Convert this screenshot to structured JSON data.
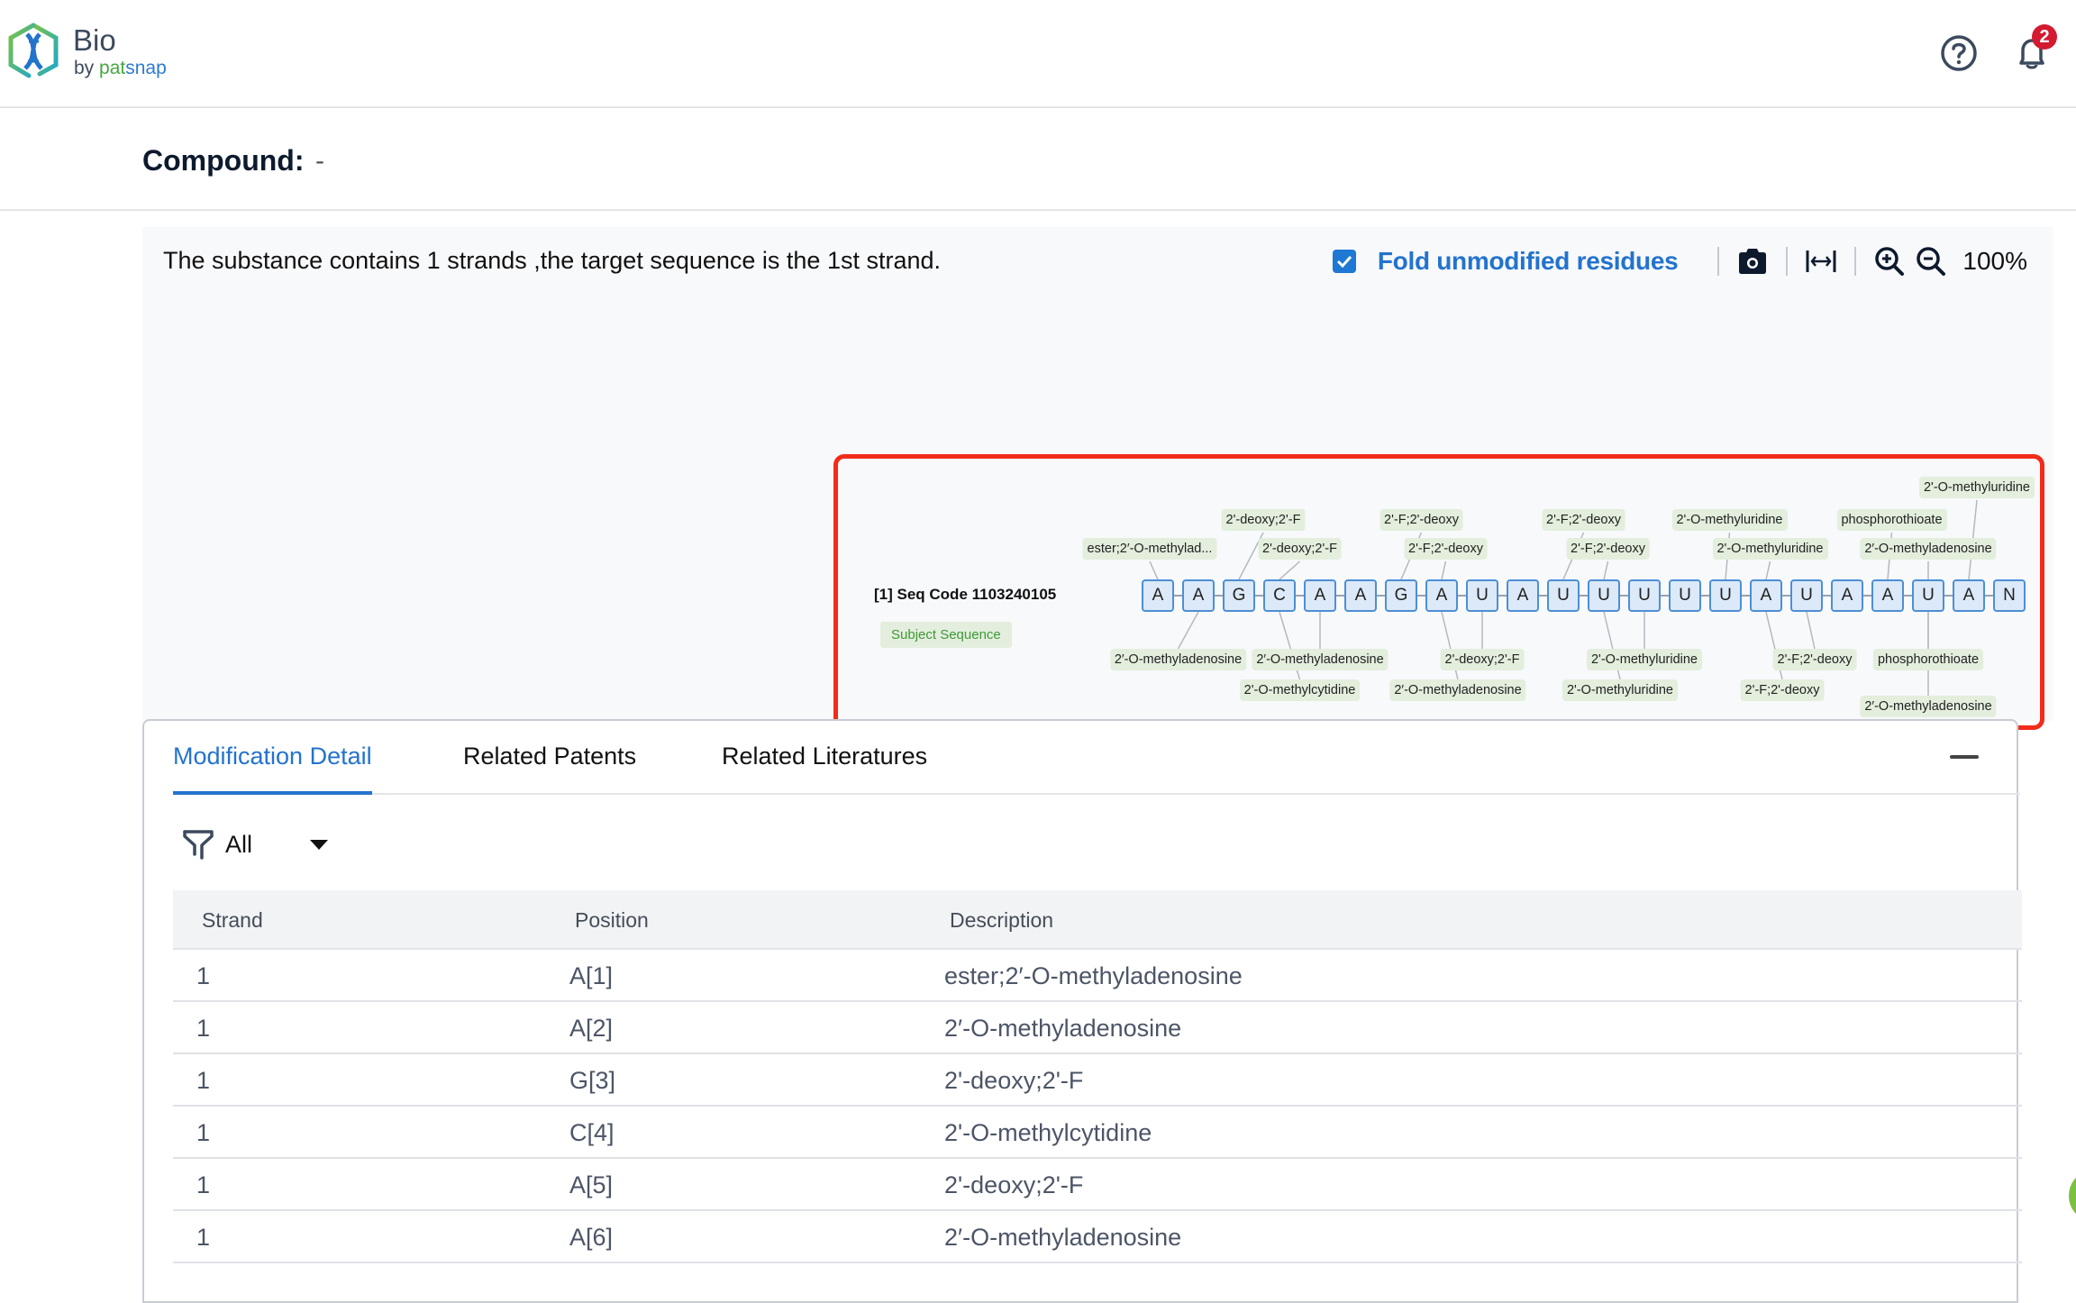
{
  "app": {
    "brand_title": "Bio",
    "brand_by": "by ",
    "brand_pat": "pat",
    "brand_snap": "snap",
    "notifications_count": "2"
  },
  "compound": {
    "label": "Compound:",
    "value": "-"
  },
  "viewer": {
    "message": "The substance contains 1 strands ,the target sequence is the 1st strand.",
    "fold_checked": true,
    "fold_label": "Fold unmodified residues",
    "zoom_level": "100%",
    "sequence_title": "[1] Seq Code 1103240105",
    "subject_tag": "Subject Sequence",
    "residues": [
      "A",
      "A",
      "G",
      "C",
      "A",
      "A",
      "G",
      "A",
      "U",
      "A",
      "U",
      "U",
      "U",
      "U",
      "U",
      "A",
      "U",
      "A",
      "A",
      "U",
      "A",
      "N"
    ],
    "modifications": [
      {
        "text": "ester;2′-O-methylad...",
        "side": "top",
        "row": 2,
        "residue": 1,
        "offset": -0.2
      },
      {
        "text": "2'-deoxy;2'-F",
        "side": "top",
        "row": 1,
        "residue": 3,
        "offset": 0.6
      },
      {
        "text": "2'-deoxy;2'-F",
        "side": "top",
        "row": 2,
        "residue": 4,
        "offset": 0.5
      },
      {
        "text": "2'-F;2'-deoxy",
        "side": "top",
        "row": 1,
        "residue": 7,
        "offset": 0.5
      },
      {
        "text": "2'-F;2'-deoxy",
        "side": "top",
        "row": 2,
        "residue": 8,
        "offset": 0.1
      },
      {
        "text": "2'-F;2'-deoxy",
        "side": "top",
        "row": 1,
        "residue": 11,
        "offset": 0.5
      },
      {
        "text": "2'-F;2'-deoxy",
        "side": "top",
        "row": 2,
        "residue": 12,
        "offset": 0.1
      },
      {
        "text": "2'-O-methyluridine",
        "side": "top",
        "row": 1,
        "residue": 15,
        "offset": 0.1
      },
      {
        "text": "2'-O-methyluridine",
        "side": "top",
        "row": 2,
        "residue": 16,
        "offset": 0.1
      },
      {
        "text": "phosphorothioate",
        "side": "top",
        "row": 1,
        "residue": 19,
        "offset": 0.1
      },
      {
        "text": "2′-O-methyladenosine",
        "side": "top",
        "row": 2,
        "residue": 20,
        "offset": 0.0
      },
      {
        "text": "2'-O-methyluridine",
        "side": "top",
        "row": 0,
        "residue": 21,
        "offset": 0.2
      },
      {
        "text": "2′-O-methyladenosine",
        "side": "bottom",
        "row": 1,
        "residue": 2,
        "offset": -0.5
      },
      {
        "text": "2′-O-methyladenosine",
        "side": "bottom",
        "row": 1,
        "residue": 5,
        "offset": 0.0
      },
      {
        "text": "2'-O-methylcytidine",
        "side": "bottom",
        "row": 2,
        "residue": 4,
        "offset": 0.5
      },
      {
        "text": "2'-deoxy;2'-F",
        "side": "bottom",
        "row": 1,
        "residue": 9,
        "offset": 0.0
      },
      {
        "text": "2′-O-methyladenosine",
        "side": "bottom",
        "row": 2,
        "residue": 8,
        "offset": 0.4
      },
      {
        "text": "2'-O-methyluridine",
        "side": "bottom",
        "row": 1,
        "residue": 13,
        "offset": 0.0
      },
      {
        "text": "2'-O-methyluridine",
        "side": "bottom",
        "row": 2,
        "residue": 12,
        "offset": 0.4
      },
      {
        "text": "2'-F;2'-deoxy",
        "side": "bottom",
        "row": 1,
        "residue": 17,
        "offset": 0.2
      },
      {
        "text": "2'-F;2'-deoxy",
        "side": "bottom",
        "row": 2,
        "residue": 16,
        "offset": 0.4
      },
      {
        "text": "phosphorothioate",
        "side": "bottom",
        "row": 1,
        "residue": 20,
        "offset": 0.0
      },
      {
        "text": "2′-O-methyladenosine",
        "side": "bottom",
        "row": 3,
        "residue": 20,
        "offset": 0.0
      }
    ]
  },
  "panel": {
    "tabs": [
      {
        "label": "Modification Detail",
        "active": true
      },
      {
        "label": "Related Patents",
        "active": false
      },
      {
        "label": "Related Literatures",
        "active": false
      }
    ],
    "filter_value": "All",
    "table": {
      "headers": [
        "Strand",
        "Position",
        "Description"
      ],
      "rows": [
        [
          "1",
          "A[1]",
          "ester;2′-O-methyladenosine"
        ],
        [
          "1",
          "A[2]",
          "2′-O-methyladenosine"
        ],
        [
          "1",
          "G[3]",
          "2'-deoxy;2'-F"
        ],
        [
          "1",
          "C[4]",
          "2'-O-methylcytidine"
        ],
        [
          "1",
          "A[5]",
          "2'-deoxy;2'-F"
        ],
        [
          "1",
          "A[6]",
          "2′-O-methyladenosine"
        ]
      ]
    }
  },
  "colors": {
    "accent": "#2373cd",
    "highlight_border": "#f22c1a",
    "badge": "#d31a30",
    "residue_fill": "#dce9f8",
    "residue_border": "#4d8fd6",
    "mod_fill": "#e3eedd"
  }
}
